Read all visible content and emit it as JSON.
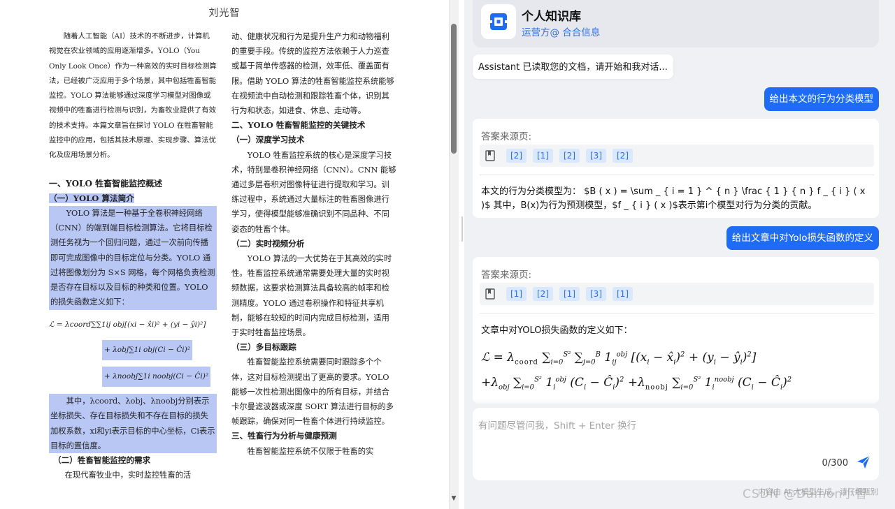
{
  "document": {
    "author": "刘光智",
    "abstract": "随着人工智能（AI）技术的不断进步，计算机视觉在农业领域的应用逐渐增多。YOLO（You Only Look Once）作为一种高效的实时目标检测算法，已经被广泛应用于多个场景，其中包括牲畜智能监控。YOLO 算法能够通过深度学习模型对图像或视频中的牲畜进行检测与识别，为畜牧业提供了有效的技术支持。本篇文章旨在探讨 YOLO 在牲畜智能监控中的应用，包括其技术原理、实现步骤、算法优化及应用场景分析。",
    "sec1_heading": "一、YOLO 牲畜智能监控概述",
    "sec1_1_heading": "（一）YOLO 算法简介",
    "sec1_1_para": "YOLO 算法是一种基于全卷积神经网络（CNN）的端到端目标检测算法。它将目标检测任务视为一个回归问题，通过一次前向传播即可完成图像中的目标定位与分类。YOLO 通过将图像划分为 S×S 网格，每个网格负责检测是否存在目标以及目标的种类和位置。YOLO 的损失函数定义如下：",
    "formula1": "ℒ = λcoord∑∑1ij obj[(xi − x̂i)² + (yi − ŷi)²]",
    "formula2": "+ λobj∑1i obj(Ci − Ĉi)²",
    "formula3": "+ λnoobj∑1i noobj(Ci − Ĉi)²",
    "sec1_1_note": "其中，λcoord、λobj、λnoobj分别表示坐标损失、存在目标损失和不存在目标的损失加权系数，xi和yi表示目标的中心坐标，Ci表示目标的置信度。",
    "sec1_2_heading": "（二）牲畜智能监控的需求",
    "sec1_2_para": "在现代畜牧业中，实时监控牲畜的活",
    "right_col_para1": "动、健康状况和行为是提升生产力和动物福利的重要手段。传统的监控方法依赖于人力巡查或基于简单传感器的检测，效率低、覆盖面有限。借助 YOLO 算法的牲畜智能监控系统能够在视频流中自动检测和跟踪牲畜个体，识别其行为和状态，如进食、休息、走动等。",
    "sec2_heading": "二、YOLO 牲畜智能监控的关键技术",
    "sec2_1_heading": "（一）深度学习技术",
    "sec2_1_para": "YOLO 牲畜监控系统的核心是深度学习技术，特别是卷积神经网络（CNN）。CNN 能够通过多层卷积对图像特征进行提取和学习。训练过程中，系统通过大量标注的牲畜图像进行学习，使得模型能够准确识别不同品种、不同姿态的牲畜个体。",
    "sec2_2_heading": "（二）实时视频分析",
    "sec2_2_para": "YOLO 算法的一大优势在于其高效的实时性。牲畜监控系统通常需要处理大量的实时视频数据，这要求检测算法具备较高的帧率和检测精度。YOLO 通过卷积操作和特征共享机制，能够在较短的时间内完成目标检测，适用于实时牲畜监控场景。",
    "sec2_3_heading": "（三）多目标跟踪",
    "sec2_3_para": "牲畜智能监控系统需要同时跟踪多个个体，这对目标检测提出了更高的要求。YOLO 能够一次性检测出图像中的所有目标，并结合卡尔曼滤波器或深度 SORT 算法进行目标的多帧跟踪，确保对同一牲畜个体进行持续监控。",
    "sec3_heading": "三、牲畜行为分析与健康预测",
    "sec3_para": "牲畜智能监控系统不仅限于牲畜的实"
  },
  "chat": {
    "app_title": "个人知识库",
    "operator": "运营方@ 合合信息",
    "greeting": "Assistant 已读取您的文档，请开始和我对话...",
    "messages": [
      {
        "role": "user",
        "text": "给出本文的行为分类模型"
      },
      {
        "role": "assistant",
        "source_label": "答案来源页:",
        "citations": [
          "[2]",
          "[1]",
          "[2]",
          "[3]",
          "[2]"
        ],
        "text": "本文的行为分类模型为： $B ( x ) = \\sum _ { i = 1 } ^ { n } \\frac { 1 } { n } f _ { i } ( x )$ 其中，B(x)为行为预测模型，$f _ { i } ( x )$表示第i个模型对行为分类的贡献。"
      },
      {
        "role": "user",
        "text": "给出文章中对Yolo损失函数的定义"
      },
      {
        "role": "assistant",
        "source_label": "答案来源页:",
        "citations": [
          "[1]",
          "[2]",
          "[1]",
          "[3]",
          "[1]"
        ],
        "text": "文章中对YOLO损失函数的定义如下："
      }
    ],
    "input_placeholder": "有问题尽管问我，Shift + Enter 换行",
    "char_count": "0/300",
    "footer_note": "内容由 AI 大模型生成，请仔细甄别",
    "watermark": "CSDN @Damon小智",
    "accent_color": "#1f6cf4"
  }
}
